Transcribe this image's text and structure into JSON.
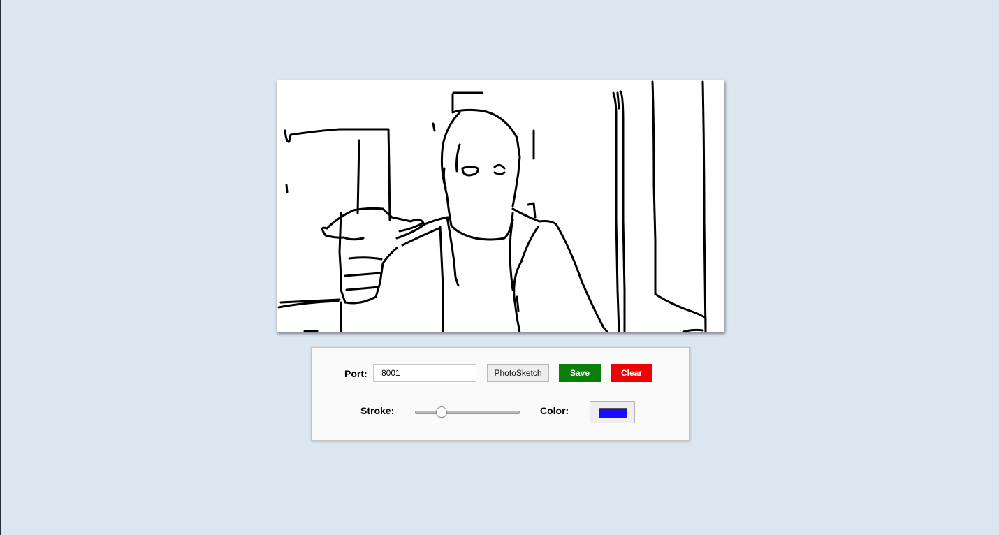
{
  "colors": {
    "background": "#dce6f0",
    "save_button": "#0a7f0a",
    "clear_button": "#f00000",
    "selected_stroke_color": "#1a0bff",
    "sketch_ink": "#000000"
  },
  "sketch_canvas": {
    "image_description_icon": "line-sketch-portrait"
  },
  "controls": {
    "port_label": "Port:",
    "port_value": "8001",
    "photosketch_label": "PhotoSketch",
    "save_label": "Save",
    "clear_label": "Clear",
    "stroke_label": "Stroke:",
    "stroke_value_fraction": 0.23,
    "color_label": "Color:"
  }
}
